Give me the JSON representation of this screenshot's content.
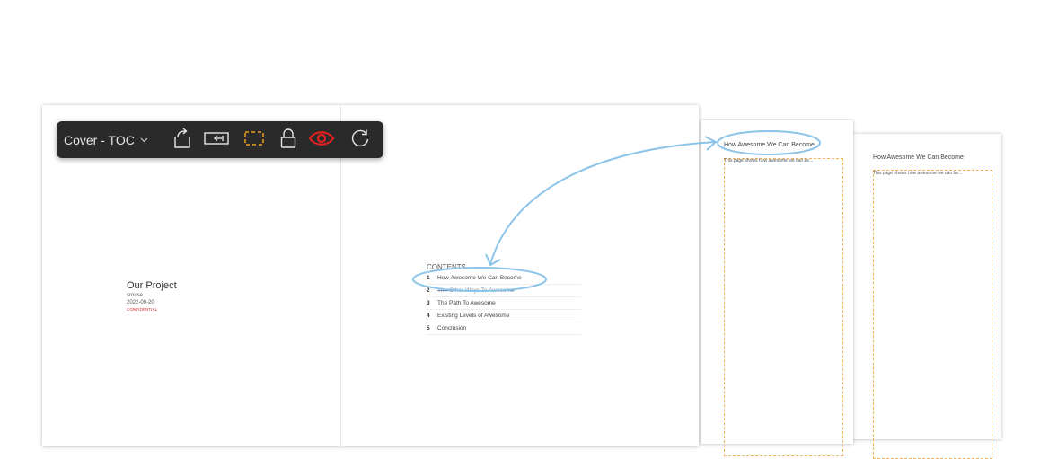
{
  "toolbar": {
    "view_selector": {
      "value": "Cover - TOC"
    },
    "buttons": [
      {
        "name": "export-icon"
      },
      {
        "name": "insert-frame-icon"
      },
      {
        "name": "frame-outline-icon",
        "color": "#f0a020"
      },
      {
        "name": "lock-icon"
      },
      {
        "name": "eye-icon",
        "color": "#e02020"
      },
      {
        "name": "refresh-icon"
      }
    ]
  },
  "cover": {
    "title": "Our Project",
    "author": "srouse",
    "date": "2022-09-20",
    "classification": "CONFIDENTIAL"
  },
  "toc": {
    "heading": "CONTENTS",
    "items": [
      {
        "num": "1",
        "label": "How Awesome We Can Become"
      },
      {
        "num": "2",
        "label": "The Other Ways To Awesome"
      },
      {
        "num": "3",
        "label": "The Path To Awesome"
      },
      {
        "num": "4",
        "label": "Existing Levels of Awesome"
      },
      {
        "num": "5",
        "label": "Conclusion"
      }
    ]
  },
  "pages": [
    {
      "title": "How Awesome We Can Become",
      "body": "This page shows how awesome we can be..."
    },
    {
      "title": "How Awesome We Can Become",
      "body": "This page shows how awesome we can be..."
    }
  ],
  "colors": {
    "link_annotation": "#8cc4ea",
    "confidential": "#d42a2a",
    "toolbar_bg": "#2a2a2a",
    "frame_dashes": "#f3b25a"
  }
}
